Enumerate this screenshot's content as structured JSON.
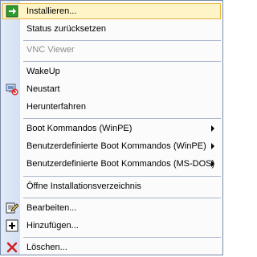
{
  "menu": {
    "items": [
      {
        "label": "Installieren...",
        "icon": "arrow-right-icon",
        "highlighted": true
      },
      {
        "label": "Status zurücksetzen"
      },
      {
        "label": "VNC Viewer",
        "disabled": true
      },
      {
        "label": "WakeUp"
      },
      {
        "label": "Neustart",
        "icon": "restart-computer-icon"
      },
      {
        "label": "Herunterfahren"
      },
      {
        "label": "Boot Kommandos (WinPE)",
        "submenu": true
      },
      {
        "label": "Benutzerdefinierte Boot Kommandos (WinPE)",
        "submenu": true
      },
      {
        "label": "Benutzerdefinierte Boot Kommandos (MS-DOS)",
        "submenu": true
      },
      {
        "label": "Öffne Installationsverzeichnis"
      },
      {
        "label": "Bearbeiten...",
        "icon": "edit-icon"
      },
      {
        "label": "Hinzufügen...",
        "icon": "add-icon"
      },
      {
        "label": "Löschen...",
        "icon": "delete-icon"
      }
    ]
  }
}
